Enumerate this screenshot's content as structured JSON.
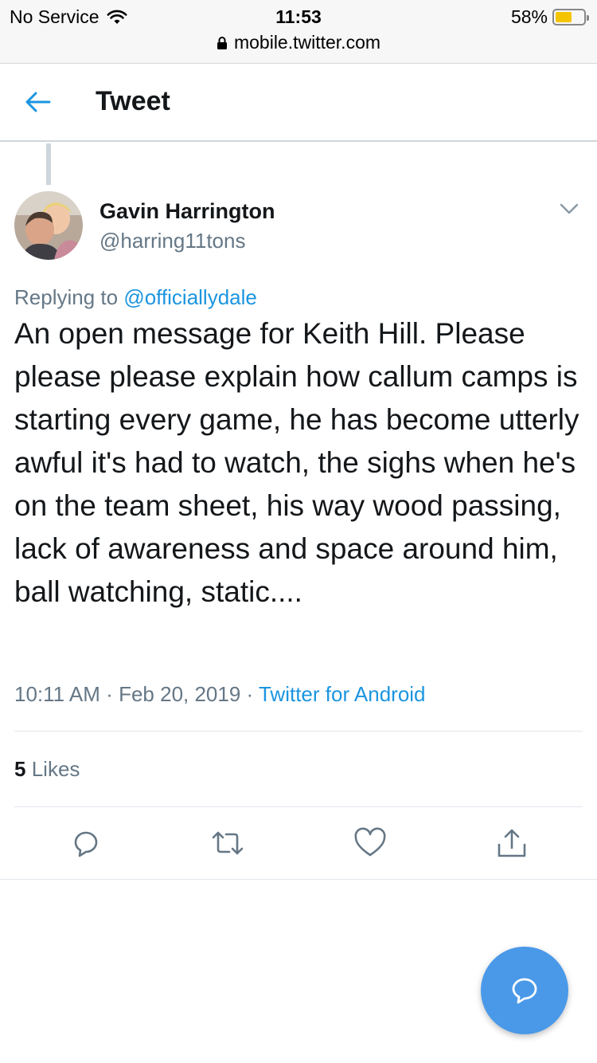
{
  "status_bar": {
    "carrier": "No Service",
    "time": "11:53",
    "battery": "58%",
    "battery_level": 0.58,
    "battery_color": "#f5c400",
    "icons": [
      "wifi-icon",
      "lock-icon",
      "battery-icon"
    ]
  },
  "url_bar": {
    "url": "mobile.twitter.com"
  },
  "header": {
    "title": "Tweet",
    "back_icon": "back-arrow-icon"
  },
  "tweet": {
    "author_name": "Gavin Harrington",
    "author_handle": "@harring11tons",
    "replying_prefix": "Replying to",
    "replying_to": "@officiallydale",
    "text": "An open message for Keith Hill. Please please please explain how callum camps is starting every game, he has become utterly awful it's had to watch, the sighs when he's on the team sheet, his way wood passing, lack of awareness and space around him, ball watching, static....",
    "time": "10:11 AM",
    "separator": "·",
    "date": "Feb 20, 2019",
    "source": "Twitter for Android",
    "likes_count": "5",
    "likes_label": "Likes"
  },
  "actions": [
    "reply-icon",
    "retweet-icon",
    "like-icon",
    "share-icon"
  ],
  "fab": {
    "icon": "compose-icon"
  },
  "colors": {
    "accent": "#1b95e0",
    "secondary_text": "#657786",
    "fab": "#4a99e9"
  }
}
